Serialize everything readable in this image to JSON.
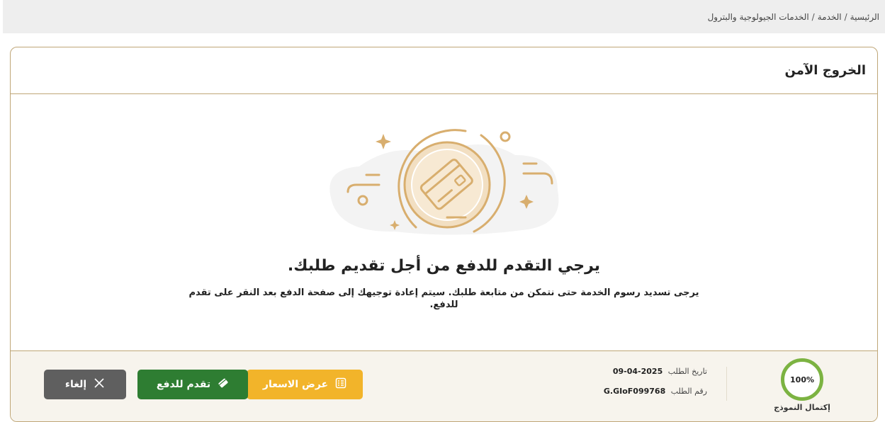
{
  "breadcrumb": {
    "home": "الرئيسية",
    "service": "الخدمة",
    "current": "الخدمات الجيولوجية والبترول",
    "separator": "/"
  },
  "card": {
    "title": "الخروج الآمن"
  },
  "illustration": {
    "icon": "credit-card-icon",
    "accent_color": "#d8ae6e",
    "badge_color": "#f2dfc2"
  },
  "message": {
    "main": "يرجي التقدم للدفع من أجل تقديم طلبك.",
    "sub": "يرجى تسديد رسوم الخدمة حتى نتمكن من متابعة طلبك. سيتم إعادة توجيهك إلى صفحة الدفع بعد النقر على تقدم للدفع."
  },
  "footer": {
    "progress_value": "100%",
    "progress_fraction": 1.0,
    "progress_label": "إكتمال النموذج",
    "request_date_label": "تاريخ الطلب",
    "request_date": "2025-04-09",
    "request_no_label": "رقم الطلب",
    "request_no": "G.GIoF099768",
    "buttons": {
      "prices": "عرض الاسعار",
      "pay": "تقدم للدفع",
      "cancel": "إلغاء"
    },
    "colors": {
      "prices": "#f2b42a",
      "pay": "#2e7d32",
      "cancel": "#5f5f5f",
      "progress": "#7cb342"
    }
  }
}
